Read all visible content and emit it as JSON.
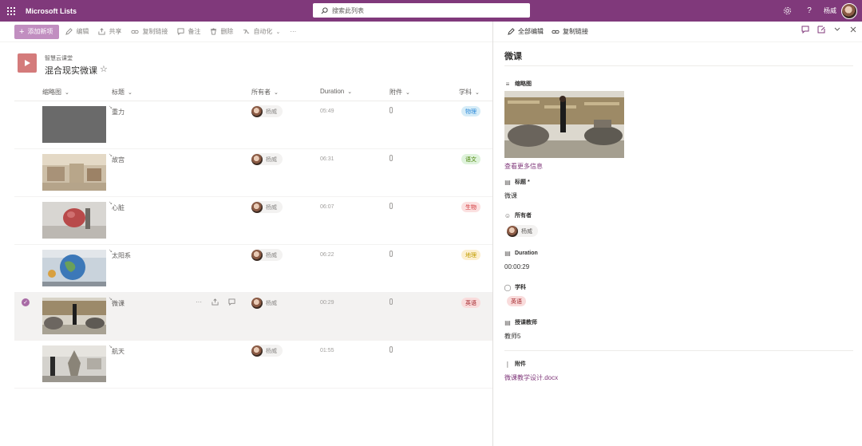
{
  "app": {
    "name": "Microsoft Lists",
    "search_placeholder": "搜索此列表",
    "user_name": "杨威",
    "help_label": "?"
  },
  "commands": {
    "new_item": "添加新项",
    "edit": "编辑",
    "share": "共享",
    "copy_link": "复制链接",
    "comment": "备注",
    "delete": "删除",
    "automate": "自动化",
    "more": "···"
  },
  "list": {
    "site": "智慧云课堂",
    "title": "混合现实微课",
    "star": "☆"
  },
  "columns": {
    "thumbnail": "缩略图",
    "title": "标题",
    "owner": "所有者",
    "duration": "Duration",
    "attachment": "附件",
    "subject": "学科"
  },
  "rows": [
    {
      "title": "重力",
      "owner": "杨威",
      "duration": "05:49",
      "subject": "物理",
      "subject_bg": "#d6ecf7",
      "subject_fg": "#2b88d8"
    },
    {
      "title": "故宫",
      "owner": "杨威",
      "duration": "06:31",
      "subject": "语文",
      "subject_bg": "#dff3dc",
      "subject_fg": "#498205"
    },
    {
      "title": "心脏",
      "owner": "杨威",
      "duration": "06:07",
      "subject": "生物",
      "subject_bg": "#fbe0e0",
      "subject_fg": "#d13438"
    },
    {
      "title": "太阳系",
      "owner": "杨威",
      "duration": "06:22",
      "subject": "地理",
      "subject_bg": "#fcefd0",
      "subject_fg": "#c19c00"
    },
    {
      "title": "微课",
      "owner": "杨威",
      "duration": "00:29",
      "subject": "英语",
      "subject_bg": "#f9dcdc",
      "subject_fg": "#a4262c"
    },
    {
      "title": "航天",
      "owner": "杨威",
      "duration": "01:55",
      "subject": "",
      "subject_bg": "",
      "subject_fg": ""
    }
  ],
  "row_actions": {
    "more": "···"
  },
  "panel": {
    "edit_all": "全部编辑",
    "copy_link": "复制链接",
    "title": "微课",
    "thumbnail_label": "缩略图",
    "more_info": "查看更多信息",
    "title_label": "标题 *",
    "title_value": "微课",
    "owner_label": "所有者",
    "owner_value": "杨威",
    "duration_label": "Duration",
    "duration_value": "00:00:29",
    "subject_label": "学科",
    "subject_value": "英语",
    "teacher_label": "授课教师",
    "teacher_value": "教师5",
    "attachment_label": "附件",
    "attachment_value": "微课教学设计.docx"
  },
  "colors": {
    "suitebar": "#80397b",
    "accent": "#c18ec0",
    "link": "#80397b"
  }
}
